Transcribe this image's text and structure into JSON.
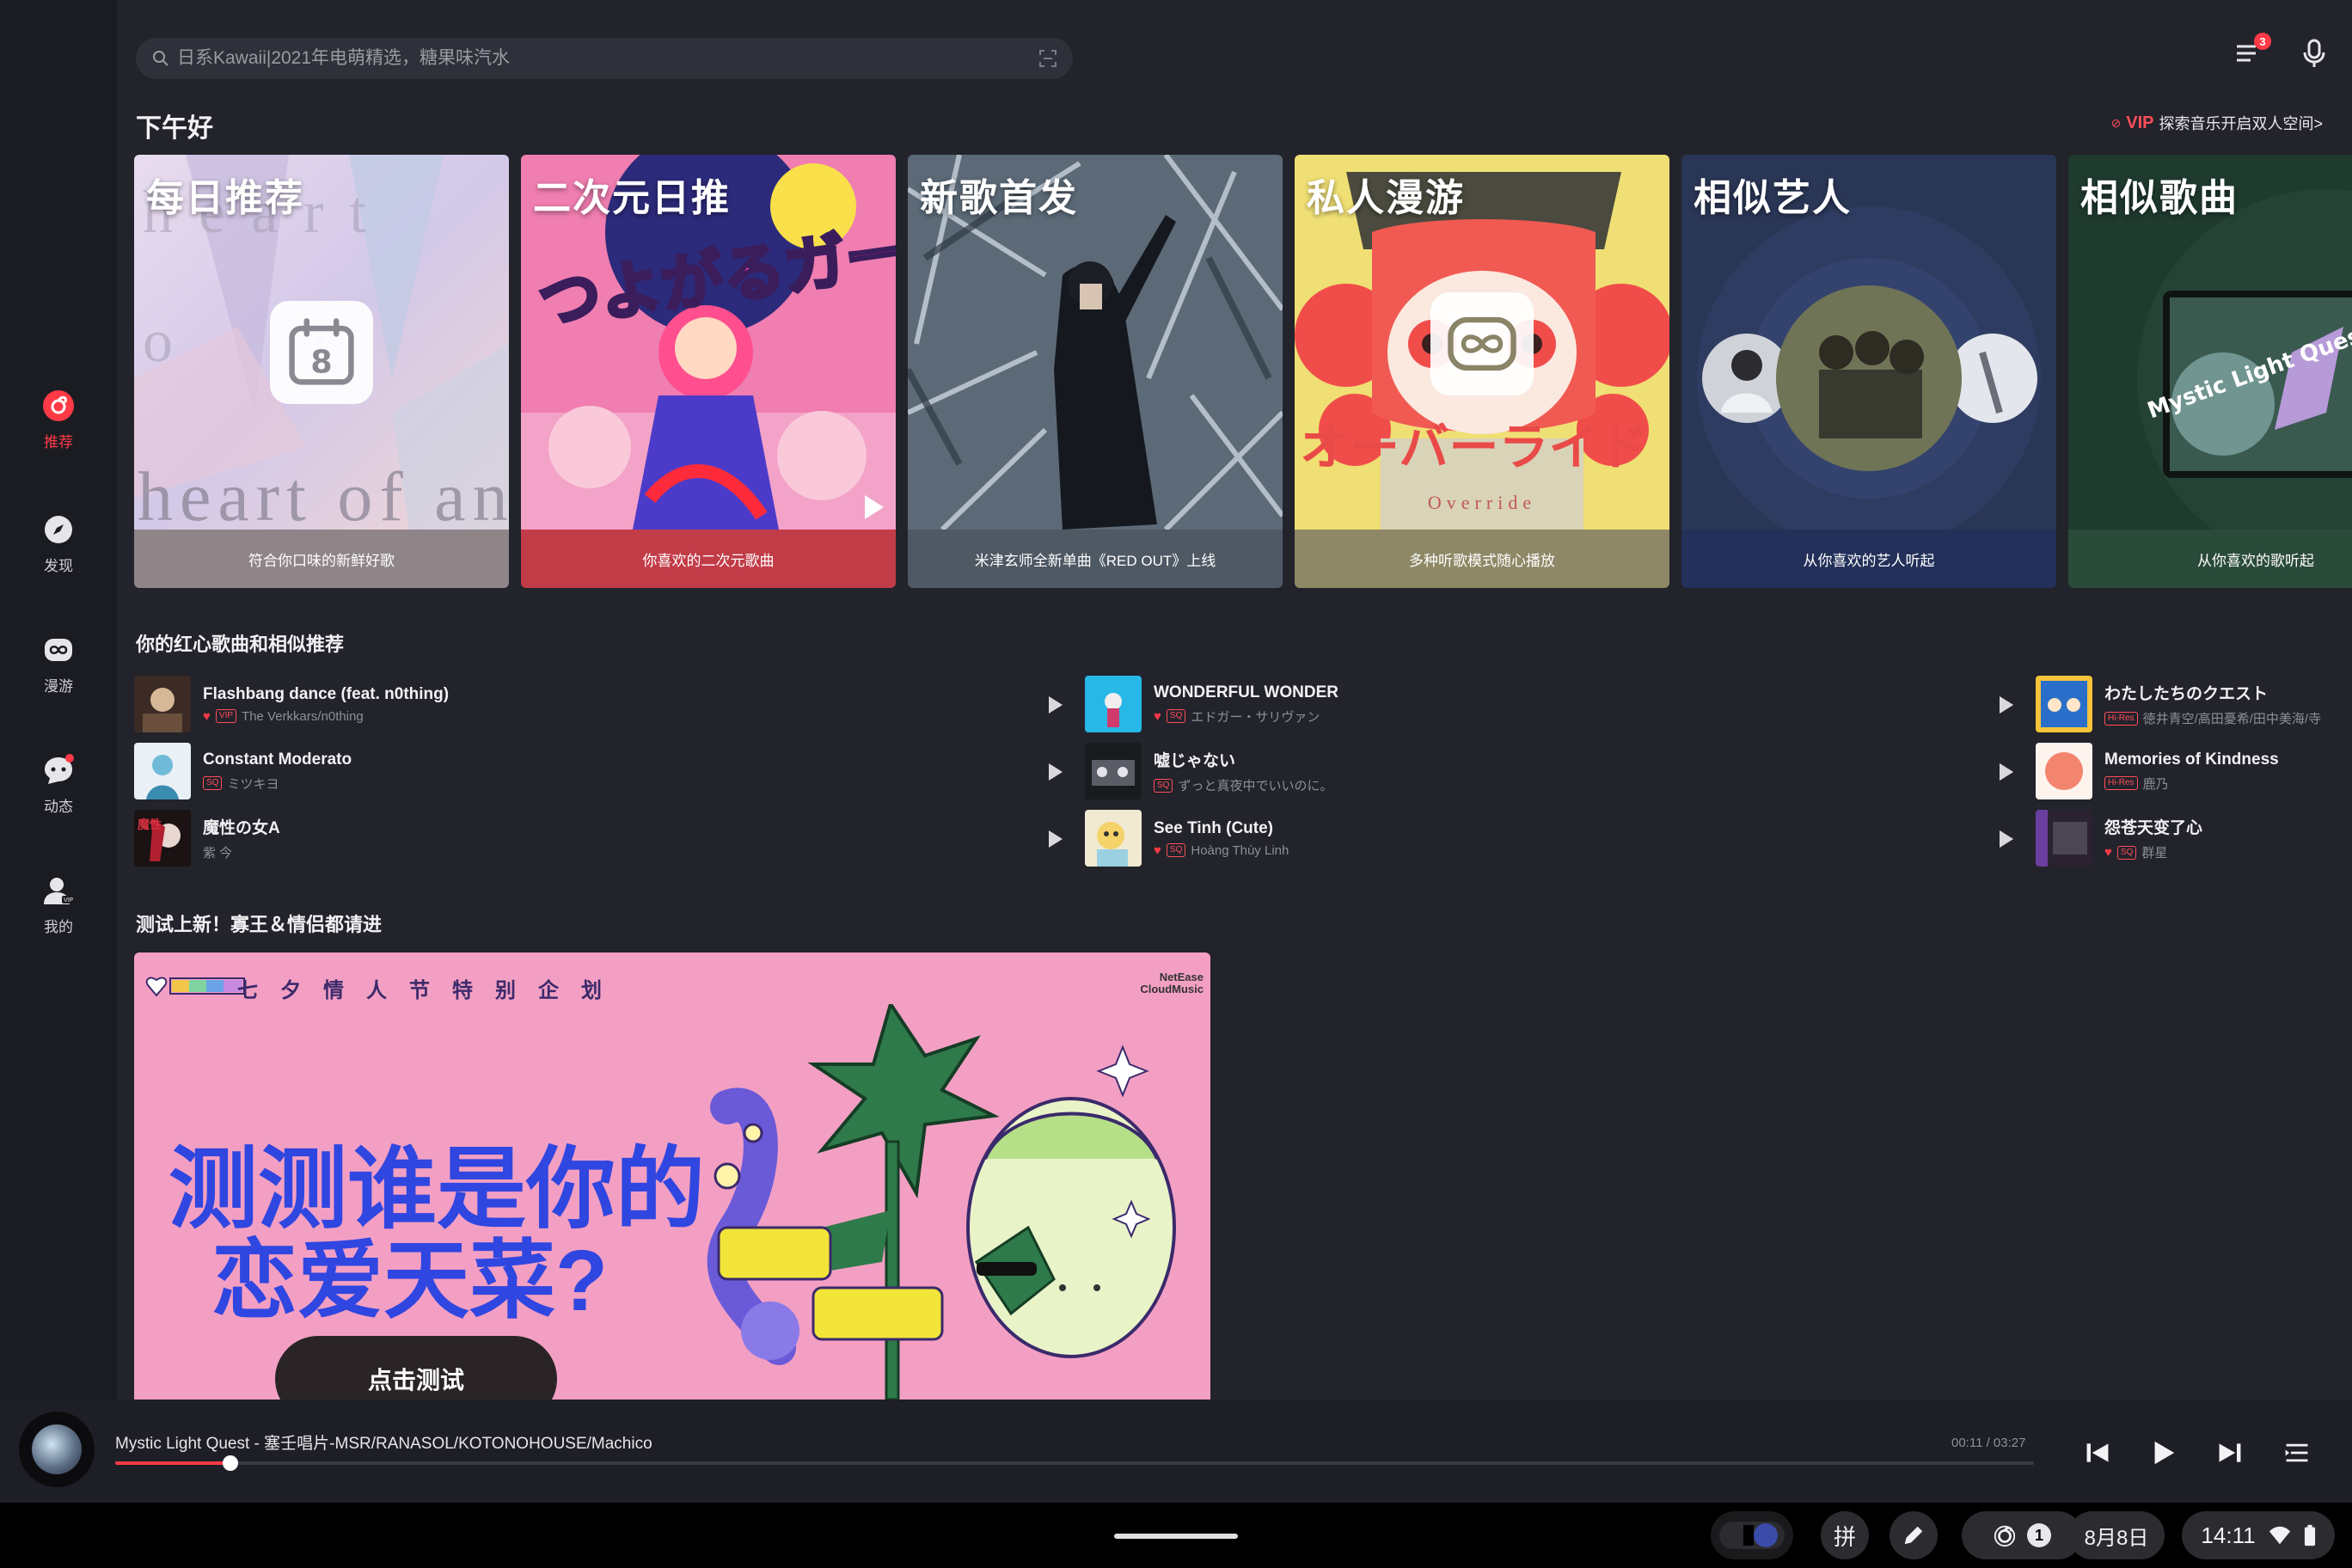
{
  "search": {
    "placeholder": "日系Kawaii|2021年电萌精选，糖果味汽水"
  },
  "header": {
    "greeting": "下午好",
    "vip_tag": "VIP",
    "vip_text": "探索音乐开启双人空间>",
    "queue_badge": "3"
  },
  "sidebar": {
    "items": [
      {
        "label": "推荐",
        "icon": "netease-logo-icon",
        "active": true
      },
      {
        "label": "发现",
        "icon": "compass-icon"
      },
      {
        "label": "漫游",
        "icon": "infinity-icon"
      },
      {
        "label": "动态",
        "icon": "chat-bubble-icon"
      },
      {
        "label": "我的",
        "icon": "user-vip-icon"
      }
    ]
  },
  "cards": [
    {
      "title": "每日推荐",
      "footer": "符合你口味的新鲜好歌",
      "icon_text": "8",
      "bg_text": "heart of android"
    },
    {
      "title": "二次元日推",
      "footer": "你喜欢的二次元歌曲",
      "art_text": "つよがるガール"
    },
    {
      "title": "新歌首发",
      "footer": "米津玄师全新单曲《RED OUT》上线"
    },
    {
      "title": "私人漫游",
      "footer": "多种听歌模式随心播放",
      "art_text": "オーバーライド",
      "art_sub": "Override"
    },
    {
      "title": "相似艺人",
      "footer": "从你喜欢的艺人听起"
    },
    {
      "title": "相似歌曲",
      "footer": "从你喜欢的歌听起",
      "art_text": "Mystic Light Quest"
    }
  ],
  "liked": {
    "title": "你的红心歌曲和相似推荐",
    "columns": [
      [
        {
          "title": "Flashbang dance (feat. n0thing)",
          "tag": "VIP",
          "artist": "The Verkkars/n0thing",
          "liked": true
        },
        {
          "title": "Constant Moderato",
          "tag": "SQ",
          "artist": "ミツキヨ",
          "liked": false
        },
        {
          "title": "魔性の女A",
          "tag": "",
          "artist": "紫 今",
          "liked": false
        }
      ],
      [
        {
          "title": "WONDERFUL WONDER",
          "tag": "SQ",
          "artist": "エドガー・サリヴァン",
          "liked": true
        },
        {
          "title": "嘘じゃない",
          "tag": "SQ",
          "artist": "ずっと真夜中でいいのに。",
          "liked": false
        },
        {
          "title": "See Tinh (Cute)",
          "tag": "SQ",
          "artist": "Hoàng Thùy Linh",
          "liked": true
        }
      ],
      [
        {
          "title": "わたしたちのクエスト",
          "tag": "Hi-Res",
          "artist": "徳井青空/高田憂希/田中美海/寺",
          "liked": false
        },
        {
          "title": "Memories of Kindness",
          "tag": "Hi-Res",
          "artist": "鹿乃",
          "liked": false
        },
        {
          "title": "怨苍天变了心",
          "tag": "SQ",
          "artist": "群星",
          "liked": true
        }
      ]
    ]
  },
  "promo": {
    "section_title": "测试上新！寡王＆情侣都请进",
    "header": "七夕情人节特别企划",
    "logo_line1": "NetEase",
    "logo_line2": "CloudMusic",
    "line1": "测测谁是你的",
    "line2": "恋爱天菜?",
    "button": "点击测试"
  },
  "player": {
    "now_playing": "Mystic Light Quest - 塞壬唱片-MSR/RANASOL/KOTONOHOUSE/Machico",
    "time": "00:11 / 03:27",
    "progress": 0.06
  },
  "system": {
    "ime": "拼",
    "notif_count": "1",
    "date": "8月8日",
    "time": "14:11"
  },
  "colors": {
    "accent": "#ff3a46",
    "background": "#22232b",
    "sidebar": "#1b1c22",
    "banner": "#f39fc3",
    "banner_text": "#3046e0"
  }
}
